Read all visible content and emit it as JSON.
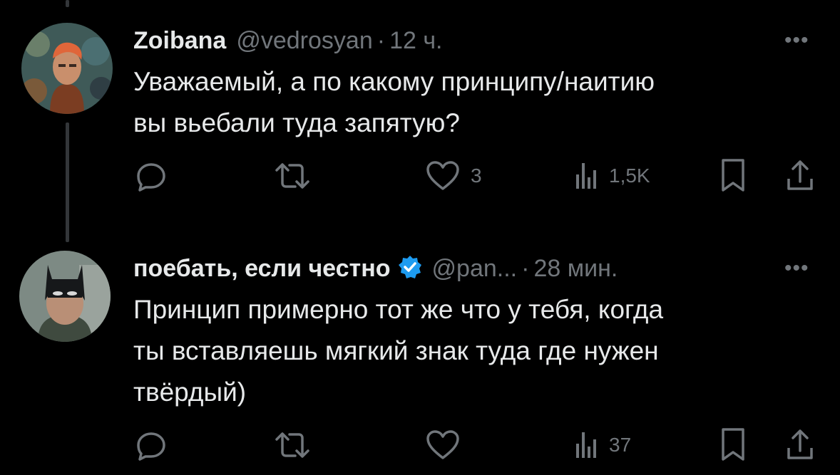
{
  "tweets": [
    {
      "name": "Zoibana",
      "handle": "@vedrosyan",
      "separator": "·",
      "time": "12 ч.",
      "more": "•••",
      "text_line1": "Уважаемый, а по какому принципу/наитию",
      "text_line2": "вы вьебали туда запятую?",
      "likes": "3",
      "views": "1,5K"
    },
    {
      "name": "поебать, если честно",
      "handle": "@pan...",
      "separator": "·",
      "time": "28 мин.",
      "more": "•••",
      "text_line1": "Принцип примерно тот же что у тебя, когда",
      "text_line2": "ты вставляешь мягкий знак туда где нужен",
      "text_line3": "твёрдый)",
      "likes": "",
      "views": "37"
    }
  ],
  "colors": {
    "background": "#000000",
    "text": "#e7e9ea",
    "muted": "#71767b",
    "verified": "#1d9bf0",
    "thread_line": "#333639"
  }
}
